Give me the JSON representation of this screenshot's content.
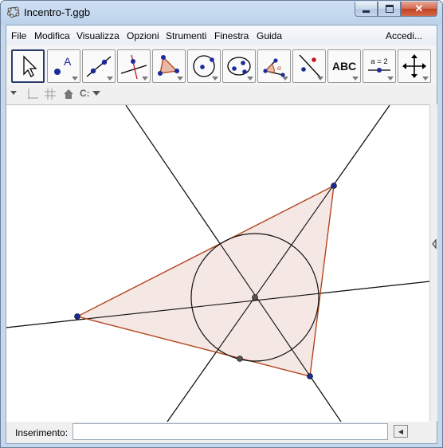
{
  "window": {
    "title": "Incentro-T.ggb",
    "app_icon": "geogebra-icon",
    "controls": [
      "minimize-icon",
      "maximize-icon",
      "close-icon"
    ]
  },
  "menubar": {
    "items": [
      "File",
      "Modifica",
      "Visualizza",
      "Opzioni",
      "Strumenti",
      "Finestra",
      "Guida"
    ],
    "right_item": "Accedi..."
  },
  "toolbar": {
    "tools": [
      {
        "name": "move-tool",
        "icon": "arrow-cursor-icon",
        "label": ""
      },
      {
        "name": "point-tool",
        "icon": "point-a-icon",
        "label": "A"
      },
      {
        "name": "line-tool",
        "icon": "line-through-points-icon",
        "label": ""
      },
      {
        "name": "perpendicular-tool",
        "icon": "perpendicular-line-icon",
        "label": ""
      },
      {
        "name": "polygon-tool",
        "icon": "polygon-icon",
        "label": ""
      },
      {
        "name": "circle-tool",
        "icon": "circle-center-point-icon",
        "label": ""
      },
      {
        "name": "conic-tool",
        "icon": "ellipse-icon",
        "label": ""
      },
      {
        "name": "angle-tool",
        "icon": "angle-icon",
        "label": "α"
      },
      {
        "name": "reflect-tool",
        "icon": "reflect-about-line-icon",
        "label": ""
      },
      {
        "name": "text-tool",
        "icon": "text-abc-icon",
        "label": "ABC"
      },
      {
        "name": "slider-tool",
        "icon": "slider-icon",
        "label": "a = 2"
      },
      {
        "name": "move-view-tool",
        "icon": "move-graphics-view-icon",
        "label": ""
      }
    ],
    "selected_tool": "move-tool"
  },
  "stylebar": {
    "items": [
      "stylebar-toggle-icon",
      "axes-icon",
      "grid-icon",
      "home-icon",
      "point-capture-icon"
    ],
    "capture_label": "C:"
  },
  "graphics_view": {
    "description_colors": {
      "triangle_fill": "#f3e6e3",
      "triangle_edge": "#b1441c",
      "lines": "#000000",
      "point_vertex": "#1a2a99",
      "point_center": "#444444"
    }
  },
  "input_bar": {
    "label": "Inserimento:",
    "value": "",
    "placeholder": ""
  }
}
